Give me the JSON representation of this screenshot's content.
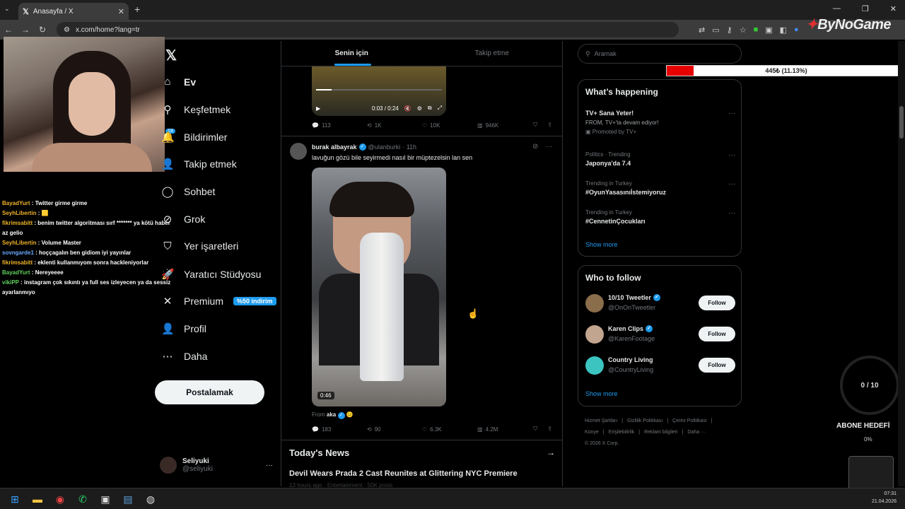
{
  "browser": {
    "tab_title": "Anasayfa / X",
    "url": "x.com/home?lang=tr",
    "brand_overlay": "ByNoGame"
  },
  "chat": [
    {
      "user": "BayadYurt",
      "msg": " : Twitter girme girme",
      "cls": "cu1"
    },
    {
      "user": "SeyhLibertin",
      "msg": " : 🟨",
      "cls": "cu1"
    },
    {
      "user": "fikrimsabitt",
      "msg": " : benim twitter algoritması sırf ******* ya kötü haber az gelio",
      "cls": "cu1"
    },
    {
      "user": "SeyhLibertin",
      "msg": " : Volume Master",
      "cls": "cu1"
    },
    {
      "user": "sovngarde1",
      "msg": " : hoççagalın ben gidiom iyi yayınlar",
      "cls": "cu3"
    },
    {
      "user": "fikrimsabitt",
      "msg": " : eklenti kullanmıyom sonra hackleniyorlar",
      "cls": "cu1"
    },
    {
      "user": "BayadYurt",
      "msg": " : Nereyeeee",
      "cls": "cu2"
    },
    {
      "user": "vikiPP",
      "msg": " : instagram çok sıkıntı ya full ses izleyecen ya da sessiz ayarlanmıyo",
      "cls": "cu2"
    }
  ],
  "sidebar": {
    "notif_count": "19",
    "items": [
      {
        "label": "Ev",
        "icon": "⌂"
      },
      {
        "label": "Keşfetmek",
        "icon": "⚲"
      },
      {
        "label": "Bildirimler",
        "icon": "🔔"
      },
      {
        "label": "Takip etmek",
        "icon": "👤"
      },
      {
        "label": "Sohbet",
        "icon": "◯"
      },
      {
        "label": "Grok",
        "icon": "⊘"
      },
      {
        "label": "Yer işaretleri",
        "icon": "⛉"
      },
      {
        "label": "Yaratıcı Stüdyosu",
        "icon": "🚀"
      },
      {
        "label": "Premium",
        "icon": "✕"
      },
      {
        "label": "Profil",
        "icon": "👤"
      },
      {
        "label": "Daha",
        "icon": "⋯"
      }
    ],
    "premium_badge": "%50 indirim",
    "post_button": "Postalamak",
    "profile_name": "Seliyuki",
    "profile_handle": "@seliyuki"
  },
  "feed": {
    "tabs": [
      "Senin için",
      "Takip etme"
    ],
    "video1": {
      "time": "0:03 / 0:24"
    },
    "post1_actions": {
      "replies": "113",
      "reposts": "1K",
      "likes": "10K",
      "views": "946K"
    },
    "post2": {
      "name": "burak albayrak",
      "handle": "@ulanburki",
      "time": "· 11h",
      "text": "lavuğun gözü bile seyirmedi nasıl bir müptezelsin lan sen",
      "duration": "0:46",
      "from_label": "From",
      "from_name": "aka",
      "replies": "183",
      "reposts": "90",
      "likes": "6.3K",
      "views": "4.2M"
    },
    "news_title": "Today's News",
    "news_item": "Devil Wears Prada 2 Cast Reunites at Glittering NYC Premiere",
    "news_meta": "13 hours ago · Entertainment · 50K posts"
  },
  "right": {
    "search_placeholder": "Aramak",
    "gift_bar": {
      "label": "445₺ (11.13%)",
      "fraction": 0.1113
    },
    "happening_title": "What’s happening",
    "trends": [
      {
        "meta": "",
        "title": "TV+ Sana Yeter!",
        "sub": "FROM, TV+'ta devam ediyor!",
        "promo": "Promoted by TV+"
      },
      {
        "meta": "Politics · Trending",
        "title": "Japonya'da 7.4"
      },
      {
        "meta": "Trending in Turkey",
        "title": "#OyunYasasınıİstemiyoruz"
      },
      {
        "meta": "Trending in Turkey",
        "title": "#CennetinÇocukları"
      }
    ],
    "show_more": "Show more",
    "wtf_title": "Who to follow",
    "follows": [
      {
        "name": "10/10 Tweetler",
        "handle": "@OnOnTweetler",
        "color": "#8a6d4a"
      },
      {
        "name": "Karen Clips",
        "handle": "@KarenFootage",
        "color": "#c2a58f"
      },
      {
        "name": "Country Living",
        "handle": "@CountryLiving",
        "color": "#3cc4c0"
      }
    ],
    "follow_label": "Follow",
    "footer": [
      "Hizmet Şartları",
      "|",
      "Gizlilik Politikası",
      "|",
      "Çerez Politikası",
      "|",
      "Künye",
      "|",
      "Erişilebilirlik",
      "|",
      "Reklam bilgileri",
      "|",
      "Daha ···",
      "© 2026 X Corp."
    ]
  },
  "overlay": {
    "goal": "0 / 10",
    "abone": "ABONE HEDEFİ",
    "abone_pct": "0%"
  },
  "clock": {
    "time": "07:31",
    "date": "21.04.2026"
  }
}
